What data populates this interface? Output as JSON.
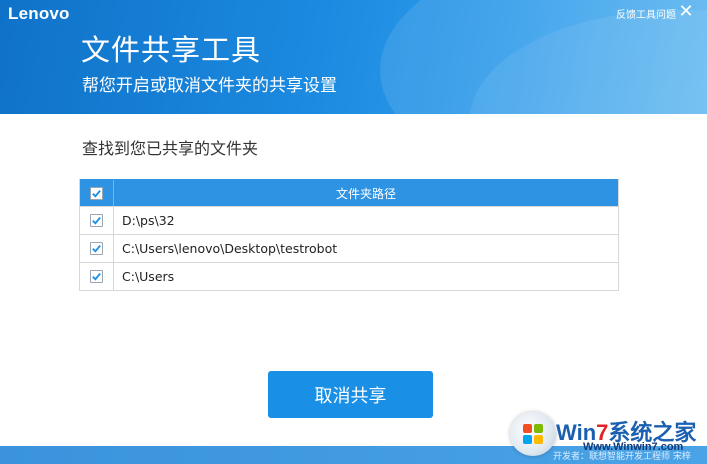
{
  "header": {
    "brand": "Lenovo",
    "feedback_link": "反馈工具问题",
    "title": "文件共享工具",
    "subtitle": "帮您开启或取消文件夹的共享设置"
  },
  "main": {
    "section_label": "查找到您已共享的文件夹",
    "table": {
      "column_header": "文件夹路径",
      "select_all_checked": true,
      "rows": [
        {
          "checked": true,
          "path": "D:\\ps\\32"
        },
        {
          "checked": true,
          "path": "C:\\Users\\lenovo\\Desktop\\testrobot"
        },
        {
          "checked": true,
          "path": "C:\\Users"
        }
      ]
    },
    "cancel_share_button": "取消共享"
  },
  "footer": {
    "text": "开发者：联想智能开发工程师 宋梓"
  },
  "watermark": {
    "brand_w": "Wi",
    "brand_n": "n",
    "brand_7": "7",
    "brand_cn": "系统之家",
    "url": "Www.Winwin7.com"
  },
  "colors": {
    "header_blue": "#1b8ae0",
    "table_header_blue": "#2f93e3",
    "button_blue": "#1a8fe6",
    "checkmark_blue": "#1a8fe6"
  },
  "icons": {
    "close": "close-icon",
    "checkbox": "checkbox-checked-icon"
  }
}
